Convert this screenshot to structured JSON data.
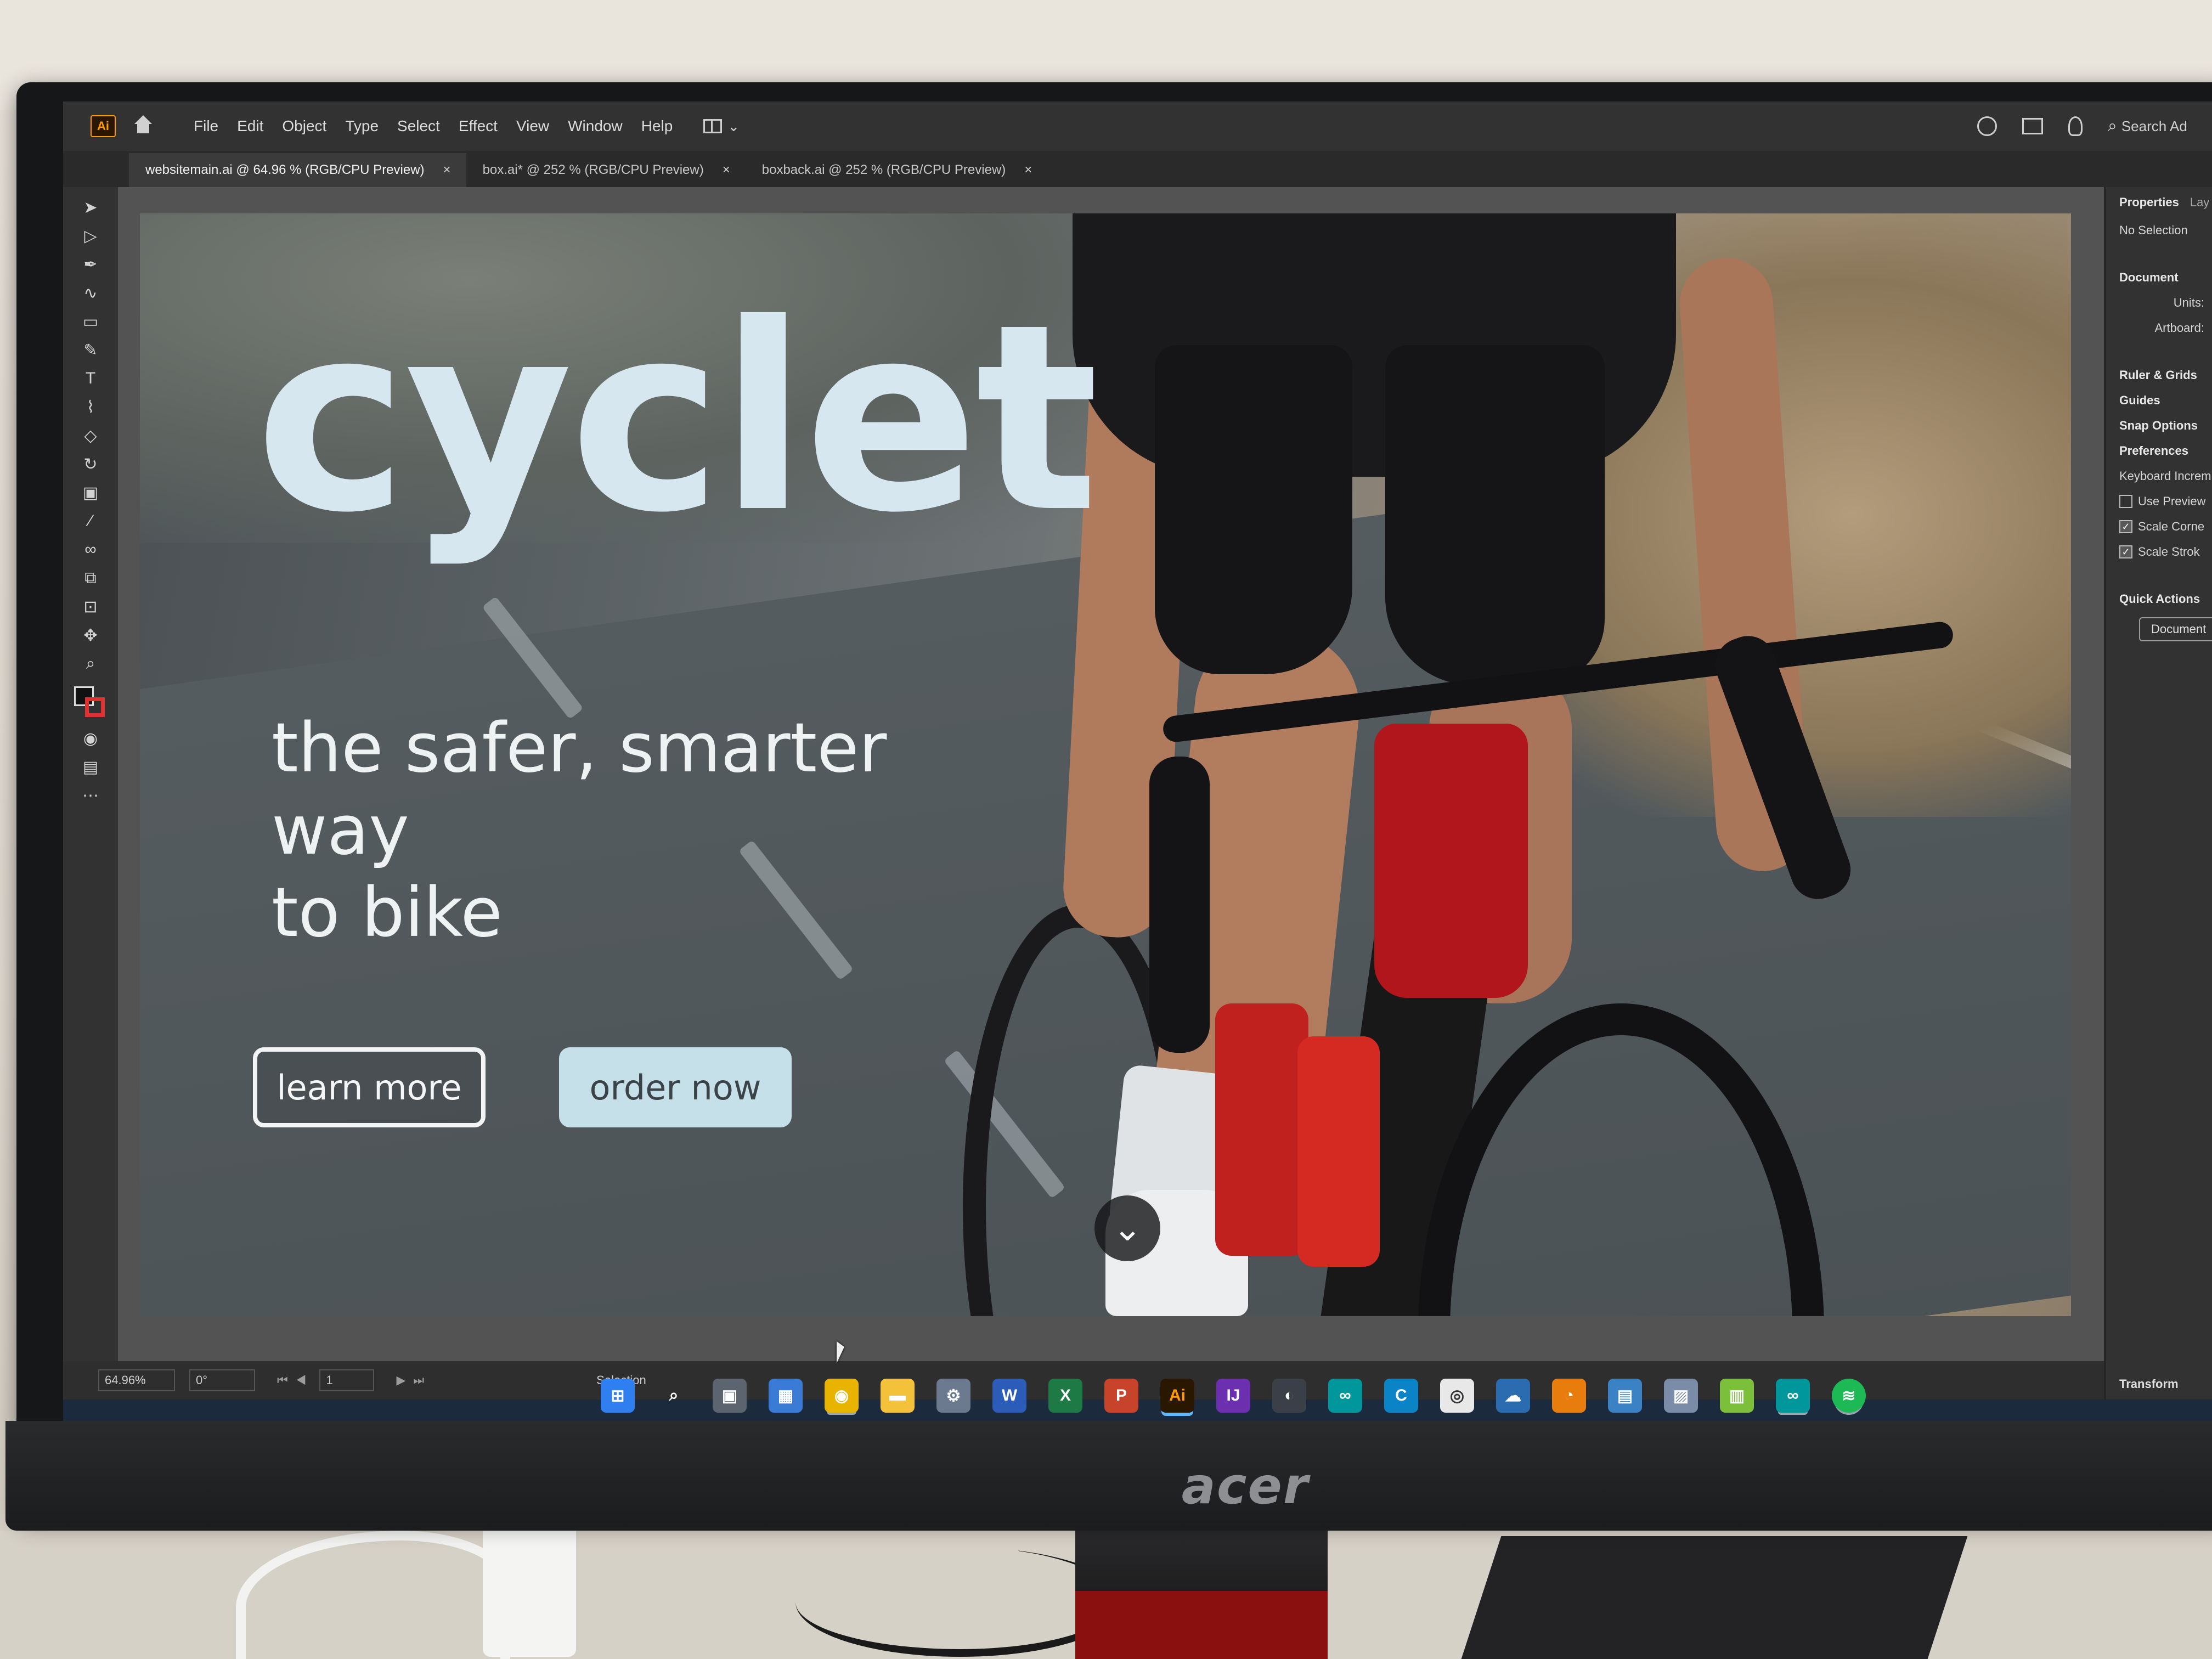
{
  "app": {
    "logo": "Ai",
    "menu": [
      "File",
      "Edit",
      "Object",
      "Type",
      "Select",
      "Effect",
      "View",
      "Window",
      "Help"
    ],
    "search_placeholder": "Search Ad"
  },
  "tabs": [
    {
      "label": "websitemain.ai @ 64.96 % (RGB/CPU Preview)",
      "active": true
    },
    {
      "label": "box.ai* @ 252 % (RGB/CPU Preview)",
      "active": false
    },
    {
      "label": "boxback.ai @ 252 % (RGB/CPU Preview)",
      "active": false
    }
  ],
  "tab_close_glyph": "×",
  "artboard": {
    "hero_title": "cyclet",
    "tagline_line1": "the safer, smarter way",
    "tagline_line2": "to bike",
    "learn_more_label": "learn more",
    "order_now_label": "order now",
    "scroll_glyph": "⌄"
  },
  "properties_panel": {
    "tab_active": "Properties",
    "tab_inactive": "Lay",
    "selection_status": "No Selection",
    "document_header": "Document",
    "units_label": "Units:",
    "artboard_label": "Artboard:",
    "sections": [
      "Ruler & Grids",
      "Guides",
      "Snap Options"
    ],
    "preferences_header": "Preferences",
    "keyboard_increment": "Keyboard Increm",
    "checkboxes": [
      {
        "label": "Use Preview",
        "checked": false
      },
      {
        "label": "Scale Corne",
        "checked": true
      },
      {
        "label": "Scale Strok",
        "checked": true
      }
    ],
    "quick_actions_header": "Quick Actions",
    "document_setup_button": "Document",
    "transform_header": "Transform"
  },
  "statusbar": {
    "zoom": "64.96%",
    "rotation": "0°",
    "artboard_number": "1",
    "mode": "Selection"
  },
  "monitor_brand": "acer",
  "colors": {
    "accent_ai": "#ff9a00",
    "site_text": "#d6e7ef",
    "order_button": "#c6e0ea",
    "taskbar": "#1c2a3d"
  },
  "taskbar_icons": [
    "windows-start-icon",
    "search-icon",
    "task-view-icon",
    "widgets-icon",
    "chrome-icon",
    "file-explorer-icon",
    "settings-icon",
    "word-icon",
    "excel-icon",
    "powerpoint-icon",
    "illustrator-icon",
    "intellij-icon",
    "app-icon",
    "arduino-icon",
    "c-app-icon",
    "browser-icon",
    "cloud-app-icon",
    "blender-icon",
    "notepad-icon",
    "paint-icon",
    "notes-icon",
    "arduino-ide-icon",
    "spotify-icon"
  ]
}
